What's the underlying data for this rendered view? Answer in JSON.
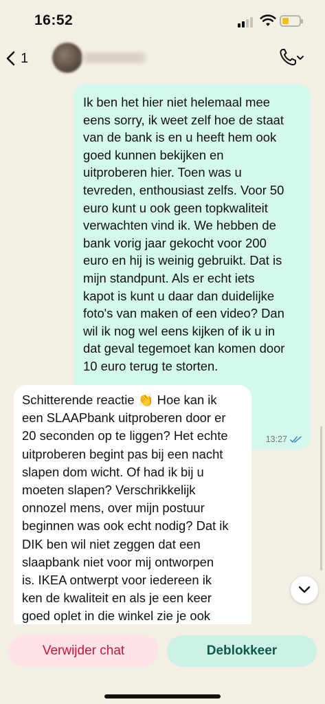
{
  "status_bar": {
    "time": "16:52",
    "battery_level": 0.4,
    "battery_color": "#f2c20a"
  },
  "header": {
    "back_icon": "chevron-left-icon",
    "unread_count": "1",
    "call_icon": "phone-icon"
  },
  "messages": [
    {
      "direction": "outgoing",
      "text": "Ik ben het hier niet helemaal mee\neens sorry, ik weet zelf hoe de staat\nvan de bank is en u heeft hem ook\ngoed kunnen bekijken en\nuitproberen hier. Toen was u\ntevreden, enthousiast zelfs. Voor 50\neuro kunt u ook geen topkwaliteit\nverwachten vind ik. We hebben de\nbank vorig jaar gekocht voor 200\neuro en hij is weinig gebruikt. Dat is\nmijn standpunt. Als er echt iets\nkapot is kunt u daar dan duidelijke\nfoto's van maken of een video? Dan\nwil ik nog wel eens kijken of ik u in\ndat geval tegemoet kan komen door\n10 euro terug te storten.",
      "time": "13:27",
      "status_icon": "double-check-icon",
      "bubble_color": "#d4f7ee"
    },
    {
      "direction": "incoming",
      "text": "Schitterende reactie 👏 Hoe kan ik\neen SLAAPbank uitproberen door er\n20 seconden op te liggen? Het echte\nuitproberen begint pas bij een nacht\nslapen dom wicht. Of had ik bij u\nmoeten slapen? Verschrikkelijk\nonnozel mens, over mijn postuur\nbeginnen was ook echt nodig? Dat ik\nDIK ben wil niet zeggen dat een\nslaapbank niet voor mij ontworpen\nis. IKEA ontwerpt voor iedereen ik\nken de kwaliteit en als je een keer\ngoed oplet in die winkel zie je ook\ndemonstratie-machines staan van",
      "bubble_color": "#ffffff"
    }
  ],
  "actions": {
    "delete_label": "Verwijder chat",
    "unblock_label": "Deblokkeer",
    "delete_color": "#c4143c",
    "unblock_color": "#0c5b4a"
  },
  "scroll_down_icon": "chevron-down-icon"
}
